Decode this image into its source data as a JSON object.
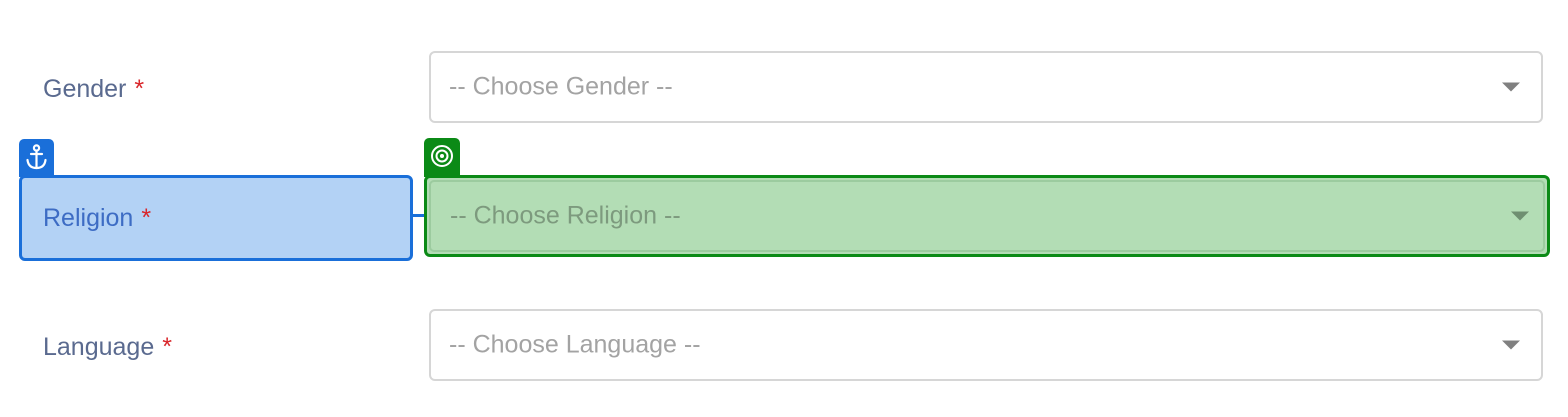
{
  "fields": [
    {
      "label": "Gender",
      "required_mark": "*",
      "placeholder": "-- Choose Gender --"
    },
    {
      "label": "Religion",
      "required_mark": "*",
      "placeholder": "-- Choose Religion --"
    },
    {
      "label": "Language",
      "required_mark": "*",
      "placeholder": "-- Choose Language --"
    }
  ],
  "overlay": {
    "anchor_icon": "anchor-icon",
    "target_icon": "target-icon",
    "anchor_color": "#1a6fd9",
    "target_color": "#0b8a16"
  },
  "colors": {
    "label": "#5a6a8f",
    "required": "#d9262a",
    "placeholder": "#a3a3a3",
    "border": "#d6d6d6"
  }
}
